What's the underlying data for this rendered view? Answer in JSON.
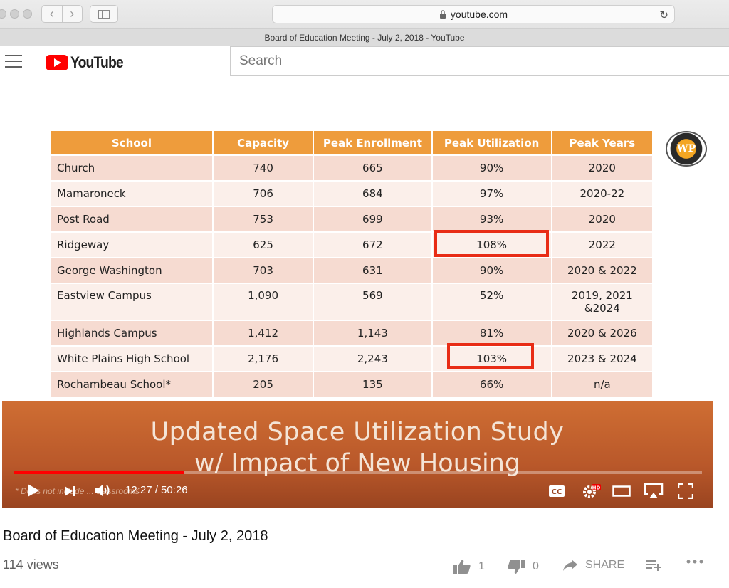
{
  "browser": {
    "url": "youtube.com",
    "tab_title": "Board of Education Meeting - July 2, 2018 - YouTube"
  },
  "youtube": {
    "logo_text": "YouTube",
    "search_placeholder": "Search"
  },
  "slide": {
    "headers": [
      "School",
      "Capacity",
      "Peak Enrollment",
      "Peak Utilization",
      "Peak Years"
    ],
    "rows": [
      [
        "Church",
        "740",
        "665",
        "90%",
        "2020"
      ],
      [
        "Mamaroneck",
        "706",
        "684",
        "97%",
        "2020-22"
      ],
      [
        "Post Road",
        "753",
        "699",
        "93%",
        "2020"
      ],
      [
        "Ridgeway",
        "625",
        "672",
        "108%",
        "2022"
      ],
      [
        "George Washington",
        "703",
        "631",
        "90%",
        "2020 & 2022"
      ],
      [
        "Eastview Campus",
        "1,090",
        "569",
        "52%",
        "2019, 2021 &2024"
      ],
      [
        "Highlands Campus",
        "1,412",
        "1,143",
        "81%",
        "2020 & 2026"
      ],
      [
        "White Plains High School",
        "2,176",
        "2,243",
        "103%",
        "2023 & 2024"
      ],
      [
        "Rochambeau School*",
        "205",
        "135",
        "66%",
        "n/a"
      ]
    ],
    "badge_text": "WP",
    "banner_line1": "Updated Space Utilization Study",
    "banner_line2": "w/ Impact of New Housing",
    "footnote": "* Does not include ... classrooms"
  },
  "player": {
    "current_time": "12:27",
    "duration": "50:26",
    "time_display": "12:27 / 50:26",
    "progress": 0.247,
    "cc_label": "CC",
    "hd_label": "HD"
  },
  "video": {
    "title": "Board of Education Meeting - July 2, 2018",
    "views": "114 views",
    "likes": "1",
    "dislikes": "0",
    "share_label": "SHARE"
  },
  "colors": {
    "header_orange": "#ee9c3c",
    "highlight_red": "#e82c16",
    "youtube_red": "#ff0000",
    "banner": "#b9582a"
  }
}
